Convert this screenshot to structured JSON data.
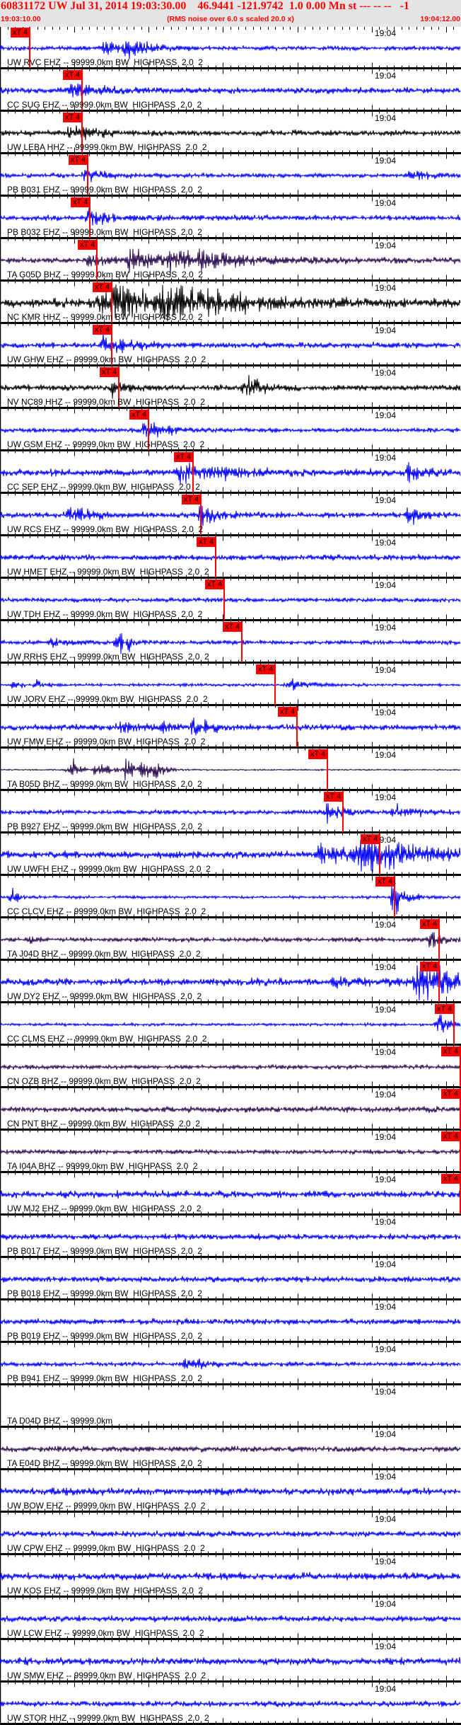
{
  "header": {
    "title": "60831172 UW Jul 31, 2014 19:03:30.00    46.9441 -121.9742  1.0 0.00 Mn st --- -- --   -1",
    "start_time": "19:03:10.00",
    "rms_note": "(RMS noise over 6.0 s scaled 20.0 x)",
    "end_time": "19:04:12.00"
  },
  "axis": {
    "span_seconds": 62,
    "minute_label": "19:04",
    "minute_seconds": 50
  },
  "pick_label": "xT 4",
  "colors": {
    "blue": "#0000ff",
    "black": "#000000",
    "purple": "#2b0b4f",
    "pick": "#ff0000"
  },
  "stations": [
    {
      "label": "UW RVC EHZ -- 99999.0km BW  HIGHPASS  2.0  2",
      "color": "blue",
      "noise": 3,
      "events": [
        [
          14,
          10,
          3
        ],
        [
          17,
          14,
          3
        ]
      ],
      "pick": 4.0
    },
    {
      "label": "CC SUG EHZ -- 99999.0km BW  HIGHPASS  2.0  2",
      "color": "blue",
      "noise": 4,
      "events": [
        [
          9.5,
          12,
          4
        ]
      ],
      "pick": 11.05
    },
    {
      "label": "UW LEBA HHZ -- 99999.0km BW  HIGHPASS  2.0  2",
      "color": "black",
      "noise": 4,
      "events": [
        [
          9.5,
          12,
          3
        ]
      ],
      "pick": 11.05
    },
    {
      "label": "PB B031 EHZ -- 99999.0km BW  HIGHPASS  2.0  2",
      "color": "blue",
      "noise": 3,
      "events": [
        [
          11.5,
          10,
          3
        ],
        [
          55,
          8,
          3
        ]
      ],
      "pick": 11.8
    },
    {
      "label": "PB B032 EHZ -- 99999.0km BW  HIGHPASS  2.0  2",
      "color": "blue",
      "noise": 4,
      "events": [
        [
          12,
          10,
          3
        ]
      ],
      "pick": 12.1
    },
    {
      "label": "TA G05D BHZ -- 99999.0km BW  HIGHPASS  2.0  2",
      "color": "purple",
      "noise": 4,
      "events": [
        [
          12,
          6,
          4
        ],
        [
          17.5,
          16,
          5
        ],
        [
          22.5,
          12,
          6
        ],
        [
          27,
          10,
          6
        ]
      ],
      "pick": 13.05
    },
    {
      "label": "NC KMR HHZ -- 99999.0km BW  HIGHPASS  2.0  2",
      "color": "black",
      "noise": 6,
      "events": [
        [
          13,
          14,
          6
        ],
        [
          15,
          22,
          6
        ],
        [
          22,
          24,
          10
        ]
      ],
      "pick": 15.05
    },
    {
      "label": "UW GHW EHZ -- 99999.0km BW  HIGHPASS  2.0  2",
      "color": "blue",
      "noise": 4,
      "events": [
        [
          14,
          18,
          3
        ]
      ],
      "pick": 15.05
    },
    {
      "label": "NV NC89 HHZ -- 99999.0km BW  HIGHPASS  2.0  2",
      "color": "black",
      "noise": 4,
      "events": [
        [
          15,
          12,
          2
        ],
        [
          33,
          22,
          2
        ]
      ],
      "pick": 16.0
    },
    {
      "label": "UW GSM EHZ -- 99999.0km BW  HIGHPASS  2.0  2",
      "color": "blue",
      "noise": 3,
      "events": [
        [
          19.5,
          16,
          3
        ]
      ],
      "pick": 20.0
    },
    {
      "label": "CC SEP EHZ -- 99999.0km BW  HIGHPASS  2.0  2",
      "color": "blue",
      "noise": 5,
      "events": [
        [
          24,
          16,
          6
        ],
        [
          55,
          16,
          2
        ]
      ],
      "pick": 26.0
    },
    {
      "label": "UW RCS EHZ -- 99999.0km BW  HIGHPASS  2.0  2",
      "color": "blue",
      "noise": 4,
      "events": [
        [
          9,
          14,
          3
        ],
        [
          27,
          18,
          2
        ],
        [
          55,
          14,
          2
        ]
      ],
      "pick": 27.05
    },
    {
      "label": "UW HMET EHZ -- 99999.0km BW  HIGHPASS  2.0  2",
      "color": "blue",
      "noise": 4,
      "events": [],
      "pick": 29.05
    },
    {
      "label": "UW TDH EHZ -- 99999.0km BW  HIGHPASS  2.0  2",
      "color": "blue",
      "noise": 3,
      "events": [],
      "pick": 30.1
    },
    {
      "label": "UW RRHS EHZ -- 99999.0km BW  HIGHPASS  2.0  2",
      "color": "blue",
      "noise": 3,
      "events": [
        [
          7,
          8,
          2
        ],
        [
          16,
          24,
          0.6
        ],
        [
          17.5,
          12,
          0.6
        ]
      ],
      "pick": 32.5
    },
    {
      "label": "UW JORV EHZ -- 99999.0km BW  HIGHPASS  2.0  2",
      "color": "blue",
      "noise": 2,
      "events": [
        [
          2,
          8,
          1
        ],
        [
          5,
          8,
          1
        ],
        [
          39,
          14,
          2
        ]
      ],
      "pick": 36.95
    },
    {
      "label": "UW FMW EHZ -- 99999.0km BW  HIGHPASS  2.0  2",
      "color": "blue",
      "noise": 4,
      "events": [
        [
          16,
          10,
          2
        ],
        [
          22,
          12,
          1
        ],
        [
          26,
          14,
          2
        ]
      ],
      "pick": 39.9
    },
    {
      "label": "TA B05D BHZ -- 99999.0km BW  HIGHPASS  2.0  2",
      "color": "purple",
      "noise": 1,
      "events": [
        [
          9.5,
          22,
          1
        ],
        [
          13,
          14,
          2
        ],
        [
          17,
          22,
          1
        ],
        [
          19,
          18,
          1
        ],
        [
          21,
          22,
          1
        ]
      ],
      "pick": 44.0
    },
    {
      "label": "PB B927 EHZ -- 99999.0km BW  HIGHPASS  2.0  2",
      "color": "blue",
      "noise": 3,
      "events": [
        [
          44,
          14,
          2
        ],
        [
          53,
          10,
          3
        ]
      ],
      "pick": 46.1
    },
    {
      "label": "UW UWFH EHZ -- 99999.0km BW  HIGHPASS  2.0  2",
      "color": "blue",
      "noise": 5,
      "events": [
        [
          43,
          16,
          4
        ],
        [
          48,
          28,
          8
        ]
      ],
      "pick": 51.05
    },
    {
      "label": "CC CLCV EHZ -- 99999.0km BW  HIGHPASS  2.0  2",
      "color": "blue",
      "noise": 2,
      "events": [
        [
          1.5,
          12,
          1
        ],
        [
          53,
          26,
          1.5
        ]
      ],
      "pick": 53.05
    },
    {
      "label": "TA J04D BHZ -- 99999.0km BW  HIGHPASS  2.0  2",
      "color": "purple",
      "noise": 3,
      "events": [
        [
          4,
          8,
          1
        ],
        [
          58,
          12,
          2
        ]
      ],
      "pick": 59.05
    },
    {
      "label": "UW DY2 EHZ -- 99999.0km BW  HIGHPASS  2.0  2",
      "color": "blue",
      "noise": 5,
      "events": [
        [
          45,
          10,
          3
        ],
        [
          56,
          28,
          6
        ]
      ],
      "pick": 59.05
    },
    {
      "label": "CC CLMS EHZ -- 99999.0km BW  HIGHPASS  2.0  2",
      "color": "blue",
      "noise": 2,
      "events": [
        [
          59,
          18,
          1.5
        ]
      ],
      "pick": 61.05
    },
    {
      "label": "CN OZB BHZ -- 99999.0km BW  HIGHPASS  2.0  2",
      "color": "purple",
      "noise": 3,
      "events": [],
      "pick": 62.0
    },
    {
      "label": "CN PNT BHZ -- 99999.0km BW  HIGHPASS  2.0  2",
      "color": "purple",
      "noise": 4,
      "events": [],
      "pick": 62.0
    },
    {
      "label": "TA I04A BHZ -- 99999.0km BW  HIGHPASS  2.0  2",
      "color": "purple",
      "noise": 3,
      "events": [],
      "pick": 62.0
    },
    {
      "label": "UW MJ2 EHZ -- 99999.0km BW  HIGHPASS  2.0  2",
      "color": "blue",
      "noise": 5,
      "events": [],
      "pick": 62.0
    },
    {
      "label": "PB B017 EHZ -- 99999.0km BW  HIGHPASS  2.0  2",
      "color": "blue",
      "noise": 4,
      "events": [],
      "pick": null
    },
    {
      "label": "PB B018 EHZ -- 99999.0km BW  HIGHPASS  2.0  2",
      "color": "blue",
      "noise": 4,
      "events": [],
      "pick": null
    },
    {
      "label": "PB B019 EHZ -- 99999.0km BW  HIGHPASS  2.0  2",
      "color": "blue",
      "noise": 4,
      "events": [],
      "pick": null
    },
    {
      "label": "PB B941 EHZ -- 99999.0km BW  HIGHPASS  2.0  2",
      "color": "blue",
      "noise": 3,
      "events": [
        [
          25,
          6,
          6
        ]
      ],
      "pick": null
    },
    {
      "label": "TA D04D BHZ -- 99999.0km",
      "color": "none",
      "noise": 0,
      "events": [],
      "pick": null
    },
    {
      "label": "TA E04D BHZ -- 99999.0km BW  HIGHPASS  2.0  2",
      "color": "purple",
      "noise": 4,
      "events": [],
      "pick": null
    },
    {
      "label": "UW BOW EHZ -- 99999.0km BW  HIGHPASS  2.0  2",
      "color": "blue",
      "noise": 5,
      "events": [],
      "pick": null
    },
    {
      "label": "UW CPW EHZ -- 99999.0km BW  HIGHPASS  2.0  2",
      "color": "blue",
      "noise": 4,
      "events": [],
      "pick": null
    },
    {
      "label": "UW KOS EHZ -- 99999.0km BW  HIGHPASS  2.0  2",
      "color": "blue",
      "noise": 5,
      "events": [],
      "pick": null
    },
    {
      "label": "UW LCW EHZ -- 99999.0km BW  HIGHPASS  2.0  2",
      "color": "blue",
      "noise": 4,
      "events": [],
      "pick": null
    },
    {
      "label": "UW SMW EHZ -- 99999.0km BW  HIGHPASS  2.0  2",
      "color": "blue",
      "noise": 5,
      "events": [],
      "pick": null
    },
    {
      "label": "UW STOR HHZ -- 99999.0km BW  HIGHPASS  2.0  2",
      "color": "blue",
      "noise": 4,
      "events": [],
      "pick": null
    }
  ]
}
